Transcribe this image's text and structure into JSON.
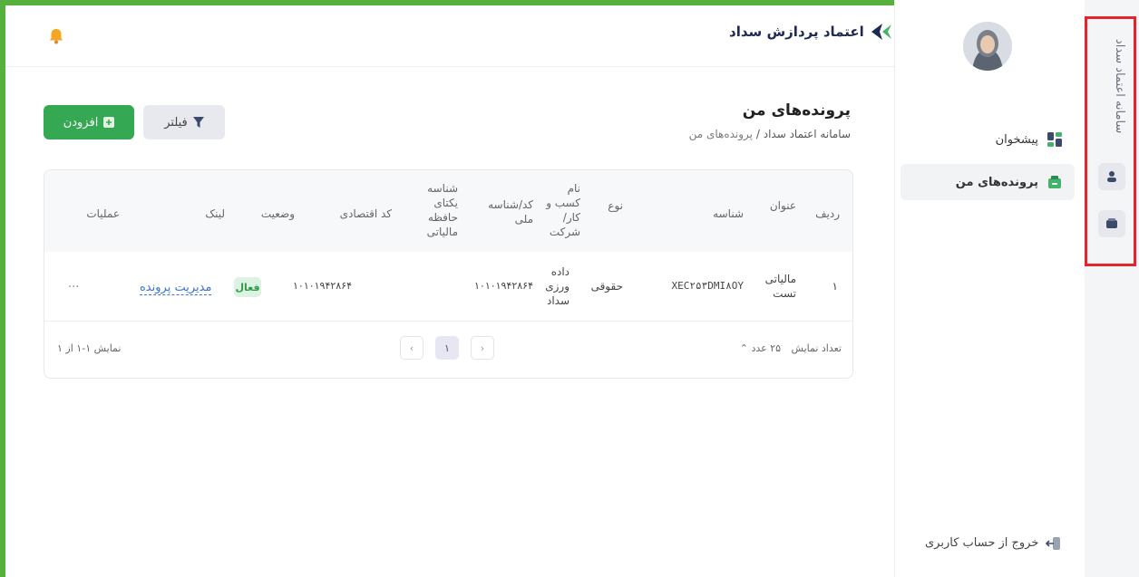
{
  "app": {
    "strip_title": "سامانه اعتماد سداد",
    "logo_text": "اعتماد پردازش سداد"
  },
  "sidebar": {
    "items": [
      {
        "label": "پیشخوان",
        "icon": "dashboard-icon"
      },
      {
        "label": "پرونده‌های من",
        "icon": "folder-icon",
        "active": true
      }
    ],
    "logout_label": "خروج از حساب کاربری"
  },
  "page": {
    "title": "پرونده‌های من",
    "breadcrumb_root": "سامانه اعتماد سداد",
    "breadcrumb_sep": "/",
    "breadcrumb_current": "پرونده‌های من",
    "filter_label": "فیلتر",
    "add_label": "افزودن"
  },
  "table": {
    "headers": {
      "row": "ردیف",
      "title": "عنوان",
      "id": "شناسه",
      "type": "نوع",
      "business_name": "نام کسب و کار/ شرکت",
      "national_code": "کد/شناسه ملی",
      "tax_memory_id": "شناسه یکتای حافظه مالیاتی",
      "economic_code": "کد اقتصادی",
      "status": "وضعیت",
      "link": "لینک",
      "actions": "عملیات"
    },
    "rows": [
      {
        "row": "۱",
        "title": "مالیاتی تست",
        "id": "XEC۲۵۳DMI۸OY",
        "type": "حقوقی",
        "business_name": "داده ورزی سداد",
        "national_code": "۱۰۱۰۱۹۴۲۸۶۴",
        "tax_memory_id": "",
        "economic_code": "۱۰۱۰۱۹۴۲۸۶۴",
        "status": "فعال",
        "link": "مدیریت پرونده",
        "actions": "..."
      }
    ]
  },
  "footer": {
    "page_size_label": "تعداد نمایش",
    "page_size_value": "۲۵ عدد",
    "current_page": "۱",
    "range_text": "نمایش ۱-۱ از ۱"
  },
  "colors": {
    "primary_green": "#35a853",
    "frame_green": "#56b13c",
    "highlight_red": "#e3262b",
    "link_blue": "#3a73d6"
  }
}
